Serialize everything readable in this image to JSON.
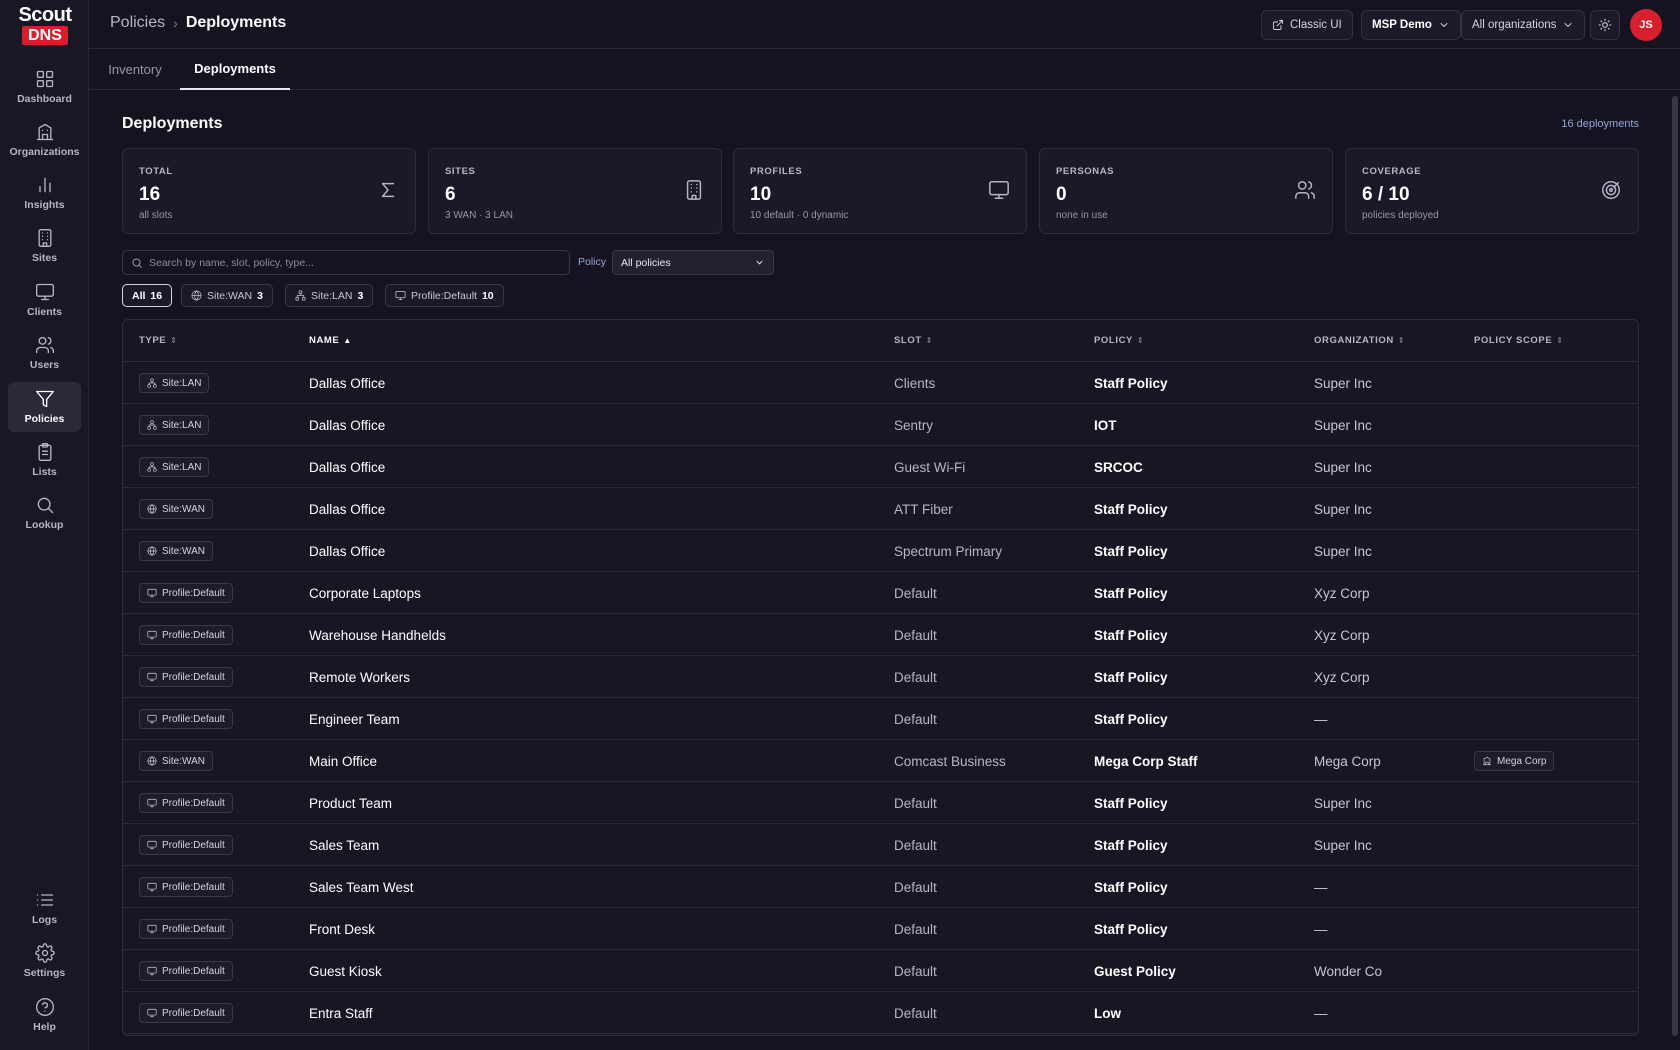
{
  "brand": {
    "scout": "Scout",
    "dns": "DNS"
  },
  "sidebar": {
    "items": [
      {
        "label": "Dashboard",
        "icon": "grid-icon"
      },
      {
        "label": "Organizations",
        "icon": "building-icon"
      },
      {
        "label": "Insights",
        "icon": "bar-chart-icon"
      },
      {
        "label": "Sites",
        "icon": "office-icon"
      },
      {
        "label": "Clients",
        "icon": "monitor-icon"
      },
      {
        "label": "Users",
        "icon": "users-icon"
      },
      {
        "label": "Policies",
        "icon": "filter-icon",
        "active": true
      },
      {
        "label": "Lists",
        "icon": "clipboard-icon"
      },
      {
        "label": "Lookup",
        "icon": "search-icon"
      }
    ],
    "bottom": [
      {
        "label": "Logs",
        "icon": "list-icon"
      },
      {
        "label": "Settings",
        "icon": "gear-icon"
      },
      {
        "label": "Help",
        "icon": "help-icon"
      }
    ]
  },
  "header": {
    "breadcrumb_parent": "Policies",
    "breadcrumb_sep": "›",
    "breadcrumb_current": "Deployments",
    "classic_ui": "Classic UI",
    "msp": "MSP Demo",
    "orgs": "All organizations",
    "avatar": "JS"
  },
  "tabs": [
    {
      "label": "Inventory"
    },
    {
      "label": "Deployments",
      "active": true
    }
  ],
  "main": {
    "title": "Deployments",
    "count_note": "16 deployments",
    "stats": [
      {
        "label": "TOTAL",
        "value": "16",
        "sub": "all slots",
        "icon": "sigma-icon"
      },
      {
        "label": "SITES",
        "value": "6",
        "sub": "3 WAN · 3 LAN",
        "icon": "office-icon"
      },
      {
        "label": "PROFILES",
        "value": "10",
        "sub": "10 default · 0 dynamic",
        "icon": "monitor-icon"
      },
      {
        "label": "PERSONAS",
        "value": "0",
        "sub": "none in use",
        "icon": "users-icon"
      },
      {
        "label": "COVERAGE",
        "value": "6 / 10",
        "sub": "policies deployed",
        "icon": "target-icon"
      }
    ],
    "search_placeholder": "Search by name, slot, policy, type...",
    "policy_label": "Policy",
    "policy_value": "All policies",
    "chips": [
      {
        "label": "All",
        "count": "16",
        "active": true,
        "icon": ""
      },
      {
        "label": "Site:WAN",
        "count": "3",
        "icon": "globe-icon"
      },
      {
        "label": "Site:LAN",
        "count": "3",
        "icon": "network-icon"
      },
      {
        "label": "Profile:Default",
        "count": "10",
        "icon": "monitor-icon"
      }
    ]
  },
  "table": {
    "headers": [
      "TYPE",
      "NAME",
      "SLOT",
      "POLICY",
      "ORGANIZATION",
      "POLICY SCOPE"
    ],
    "sort_glyph": "⇕",
    "sorted_glyph": "▲",
    "rows": [
      {
        "type": "Site:LAN",
        "type_icon": "network-icon",
        "name": "Dallas Office",
        "slot": "Clients",
        "policy": "Staff Policy",
        "org": "Super Inc",
        "scope": ""
      },
      {
        "type": "Site:LAN",
        "type_icon": "network-icon",
        "name": "Dallas Office",
        "slot": "Sentry",
        "policy": "IOT",
        "org": "Super Inc",
        "scope": ""
      },
      {
        "type": "Site:LAN",
        "type_icon": "network-icon",
        "name": "Dallas Office",
        "slot": "Guest Wi-Fi",
        "policy": "SRCOC",
        "org": "Super Inc",
        "scope": ""
      },
      {
        "type": "Site:WAN",
        "type_icon": "globe-icon",
        "name": "Dallas Office",
        "slot": "ATT Fiber",
        "policy": "Staff Policy",
        "org": "Super Inc",
        "scope": ""
      },
      {
        "type": "Site:WAN",
        "type_icon": "globe-icon",
        "name": "Dallas Office",
        "slot": "Spectrum Primary",
        "policy": "Staff Policy",
        "org": "Super Inc",
        "scope": ""
      },
      {
        "type": "Profile:Default",
        "type_icon": "monitor-icon",
        "name": "Corporate Laptops",
        "slot": "Default",
        "policy": "Staff Policy",
        "org": "Xyz Corp",
        "scope": ""
      },
      {
        "type": "Profile:Default",
        "type_icon": "monitor-icon",
        "name": "Warehouse Handhelds",
        "slot": "Default",
        "policy": "Staff Policy",
        "org": "Xyz Corp",
        "scope": ""
      },
      {
        "type": "Profile:Default",
        "type_icon": "monitor-icon",
        "name": "Remote Workers",
        "slot": "Default",
        "policy": "Staff Policy",
        "org": "Xyz Corp",
        "scope": ""
      },
      {
        "type": "Profile:Default",
        "type_icon": "monitor-icon",
        "name": "Engineer Team",
        "slot": "Default",
        "policy": "Staff Policy",
        "org": "—",
        "scope": ""
      },
      {
        "type": "Site:WAN",
        "type_icon": "globe-icon",
        "name": "Main Office",
        "slot": "Comcast Business",
        "policy": "Mega Corp Staff",
        "org": "Mega Corp",
        "scope": "Mega Corp"
      },
      {
        "type": "Profile:Default",
        "type_icon": "monitor-icon",
        "name": "Product Team",
        "slot": "Default",
        "policy": "Staff Policy",
        "org": "Super Inc",
        "scope": ""
      },
      {
        "type": "Profile:Default",
        "type_icon": "monitor-icon",
        "name": "Sales Team",
        "slot": "Default",
        "policy": "Staff Policy",
        "org": "Super Inc",
        "scope": ""
      },
      {
        "type": "Profile:Default",
        "type_icon": "monitor-icon",
        "name": "Sales Team West",
        "slot": "Default",
        "policy": "Staff Policy",
        "org": "—",
        "scope": ""
      },
      {
        "type": "Profile:Default",
        "type_icon": "monitor-icon",
        "name": "Front Desk",
        "slot": "Default",
        "policy": "Staff Policy",
        "org": "—",
        "scope": ""
      },
      {
        "type": "Profile:Default",
        "type_icon": "monitor-icon",
        "name": "Guest Kiosk",
        "slot": "Default",
        "policy": "Guest Policy",
        "org": "Wonder Co",
        "scope": ""
      },
      {
        "type": "Profile:Default",
        "type_icon": "monitor-icon",
        "name": "Entra Staff",
        "slot": "Default",
        "policy": "Low",
        "org": "—",
        "scope": ""
      }
    ]
  },
  "colors": {
    "accent": "#d71f2d",
    "background": "#161320",
    "link": "#8fa8d8"
  }
}
